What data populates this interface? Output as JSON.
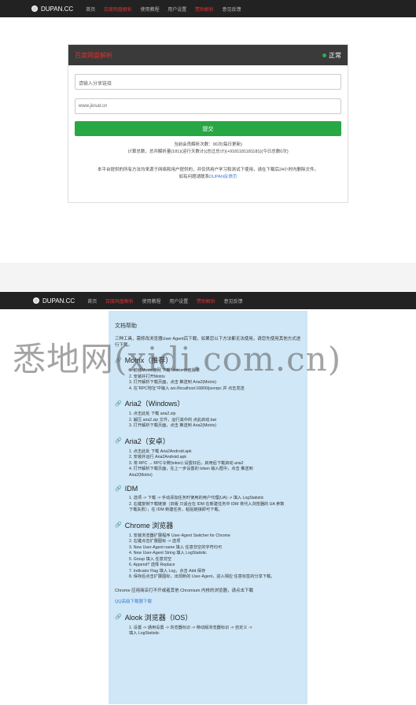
{
  "nav": {
    "brand": "DUPAN.CC",
    "items": [
      "首页",
      "百度网盘解析",
      "使用教程",
      "用户设置",
      "赞助解析",
      "意见反馈"
    ]
  },
  "panel": {
    "title": "百度网盘解析",
    "status": "正常",
    "link_placeholder": "请输入分享链接",
    "pwd_placeholder": "www.jiosat.cn",
    "submit_label": "提交",
    "stat_line1": "当前会员解析次数：00次(每日更新)",
    "stat_line2": "计算总数，总共解析量(181)(运行天数计)(总过总计)(+9181181181181)(今日总数0次)",
    "note_line1": "本平台提供的所有方法均来源于网络和用户提供的，并仅供用户学习和测试下使用，请在下载后24小时内删除文件。",
    "note_line2_prefix": "如有问题请联系",
    "note_link": "DUPAN反馈页"
  },
  "doc": {
    "header": "文档帮助",
    "intro": "三种工具，需修改浏览器User Agent后下载，如果您以下方法都无法使用，请您先使用其他方式进行下载。",
    "sections": [
      {
        "title": "Motrix（推荐）",
        "items": [
          "1. 前往Motrix官网 下载 Motrix 对应版本",
          "2. 安装并打开Motrix",
          "3. 打开解析下载页面，点击 推送到 Aria2(Motrix)",
          "4. 在“RPC地址”中输入 ws://localhost:16800/jsonrpc 并 点击发送"
        ]
      },
      {
        "title": "Aria2（Windows）",
        "items": [
          "1. 点击此处 下载 aria2.zip",
          "2. 解压 aria2.zip 文件，运行其中的 点此启动.bat",
          "3. 打开解析下载页面，点击 推送到 Aria2(Motrix)"
        ]
      },
      {
        "title": "Aria2（安卓）",
        "items": [
          "1. 点击此处 下载 Aria2Android.apk",
          "2. 安装并运行 Aria2Android.apk",
          "3. 将 RPC → RPC令牌(token) 设置好后，启用后下载启动 aria2",
          "4. 打开解析下载页面，在上一步设置的 token 输入框中，点击 推送到",
          "   Aria2(Motrix)"
        ]
      },
      {
        "title": "IDM",
        "items": [
          "1. 选项 -> 下载 -> 手动添加任务时使用的用户代理(UA) -> 填入 LogStatistic",
          "2. 右键复制下载链接（旧版 只适合在 IDM 在新建任务中 IDM 将代入浏览器的 UA 参数",
          "   下载失败），在 IDM 新建任务，粘贴链接即可下载。"
        ]
      },
      {
        "title": "Chrome 浏览器",
        "items": [
          "1. 安装浏览器扩展程序 User-Agent Switcher for Chrome",
          "2. 右键点击扩展图标 -> 选项",
          "3. New User-Agent name 填入 任意非空的字符均可",
          "4. New User-Agent String 填入 LogStatistic",
          "5. Group 填入 任意非空",
          "6. Append? 选择 Replace",
          "7. Indicator Flag 填入 Log，点击 Add 保存",
          "8. 保存后点击扩展图标，出现新的 User-Agent，进入相应 任意标签的分享下载。"
        ]
      }
    ],
    "chrome_note": "Chrome 应用商店打不开或者其他 Chromium 内核的浏览器，请点击下载",
    "qq_link": "QQ高级下载器下载",
    "last_section": {
      "title": "Alook 浏览器（IOS）",
      "items": [
        "1. 设置 -> 通用设置 -> 浏览器标识 -> 移动版浏览器标识 -> 自定义 ->",
        "   填入 LogStatistic"
      ]
    }
  },
  "watermark": "悉地网(xidi.com.cn)"
}
